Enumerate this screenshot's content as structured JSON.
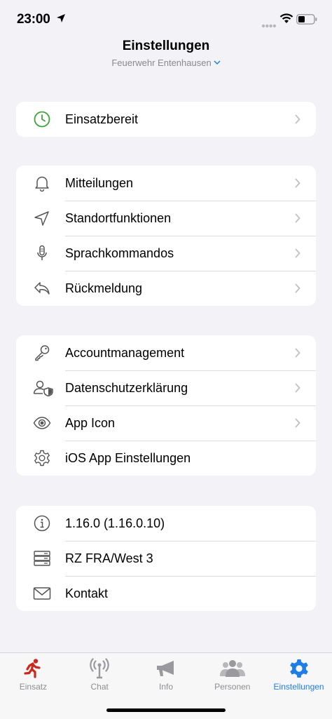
{
  "status_bar": {
    "time": "23:00"
  },
  "header": {
    "title": "Einstellungen",
    "subtitle": "Feuerwehr Entenhausen"
  },
  "groups": [
    {
      "items": [
        {
          "label": "Einsatzbereit",
          "icon": "clock-icon",
          "chevron": true
        }
      ]
    },
    {
      "items": [
        {
          "label": "Mitteilungen",
          "icon": "bell-icon",
          "chevron": true
        },
        {
          "label": "Standortfunktionen",
          "icon": "location-arrow-icon",
          "chevron": true
        },
        {
          "label": "Sprachkommandos",
          "icon": "microphone-icon",
          "chevron": true
        },
        {
          "label": "Rückmeldung",
          "icon": "reply-arrow-icon",
          "chevron": true
        }
      ]
    },
    {
      "items": [
        {
          "label": "Accountmanagement",
          "icon": "key-icon",
          "chevron": true
        },
        {
          "label": "Datenschutzerklärung",
          "icon": "user-shield-icon",
          "chevron": true
        },
        {
          "label": "App Icon",
          "icon": "eye-icon",
          "chevron": true
        },
        {
          "label": "iOS App Einstellungen",
          "icon": "gear-icon",
          "chevron": false
        }
      ]
    },
    {
      "items": [
        {
          "label": "1.16.0 (1.16.0.10)",
          "icon": "info-icon",
          "chevron": false
        },
        {
          "label": "RZ FRA/West 3",
          "icon": "server-icon",
          "chevron": false
        },
        {
          "label": "Kontakt",
          "icon": "envelope-icon",
          "chevron": false
        }
      ]
    }
  ],
  "tabs": [
    {
      "label": "Einsatz",
      "icon": "running-person-icon",
      "active": false
    },
    {
      "label": "Chat",
      "icon": "antenna-icon",
      "active": false
    },
    {
      "label": "Info",
      "icon": "megaphone-icon",
      "active": false
    },
    {
      "label": "Personen",
      "icon": "people-icon",
      "active": false
    },
    {
      "label": "Einstellungen",
      "icon": "gear-icon",
      "active": true
    }
  ],
  "colors": {
    "accent": "#1f7de6",
    "ready_green": "#3aa33a",
    "einsatz_red": "#c8281e",
    "background": "#f2f2f7"
  }
}
